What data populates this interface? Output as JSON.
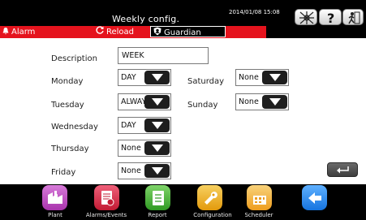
{
  "header": {
    "title": "Weekly config.",
    "datetime": "2014/01/08 15:08",
    "alarm_label": "Alarm",
    "reload_label": "Reload",
    "user_label": "Guardian"
  },
  "form": {
    "description_label": "Description",
    "description_value": "WEEK",
    "days": {
      "monday": {
        "label": "Monday",
        "value": "DAY"
      },
      "tuesday": {
        "label": "Tuesday",
        "value": "ALWAYS"
      },
      "wednesday": {
        "label": "Wednesday",
        "value": "DAY"
      },
      "thursday": {
        "label": "Thursday",
        "value": "None"
      },
      "friday": {
        "label": "Friday",
        "value": "None"
      },
      "saturday": {
        "label": "Saturday",
        "value": "None"
      },
      "sunday": {
        "label": "Sunday",
        "value": "None"
      }
    }
  },
  "nav": {
    "plant": "Plant",
    "alarms_events": "Alarms/Events",
    "report": "Report",
    "configuration": "Configuration",
    "scheduler": "Scheduler"
  },
  "colors": {
    "alarm_bar": "#e5131d",
    "plant": "#c04cc4",
    "alarms": "#e0324a",
    "report": "#4fb83c",
    "configuration": "#f2b21a",
    "scheduler": "#f5b33a",
    "back": "#2a8ef0"
  },
  "icons": {
    "network": "network-icon",
    "help": "help-icon",
    "exit": "exit-icon",
    "alarm": "bell-icon",
    "reload": "reload-icon",
    "user": "user-shield-icon",
    "enter": "enter-icon",
    "back": "back-arrow-icon"
  }
}
